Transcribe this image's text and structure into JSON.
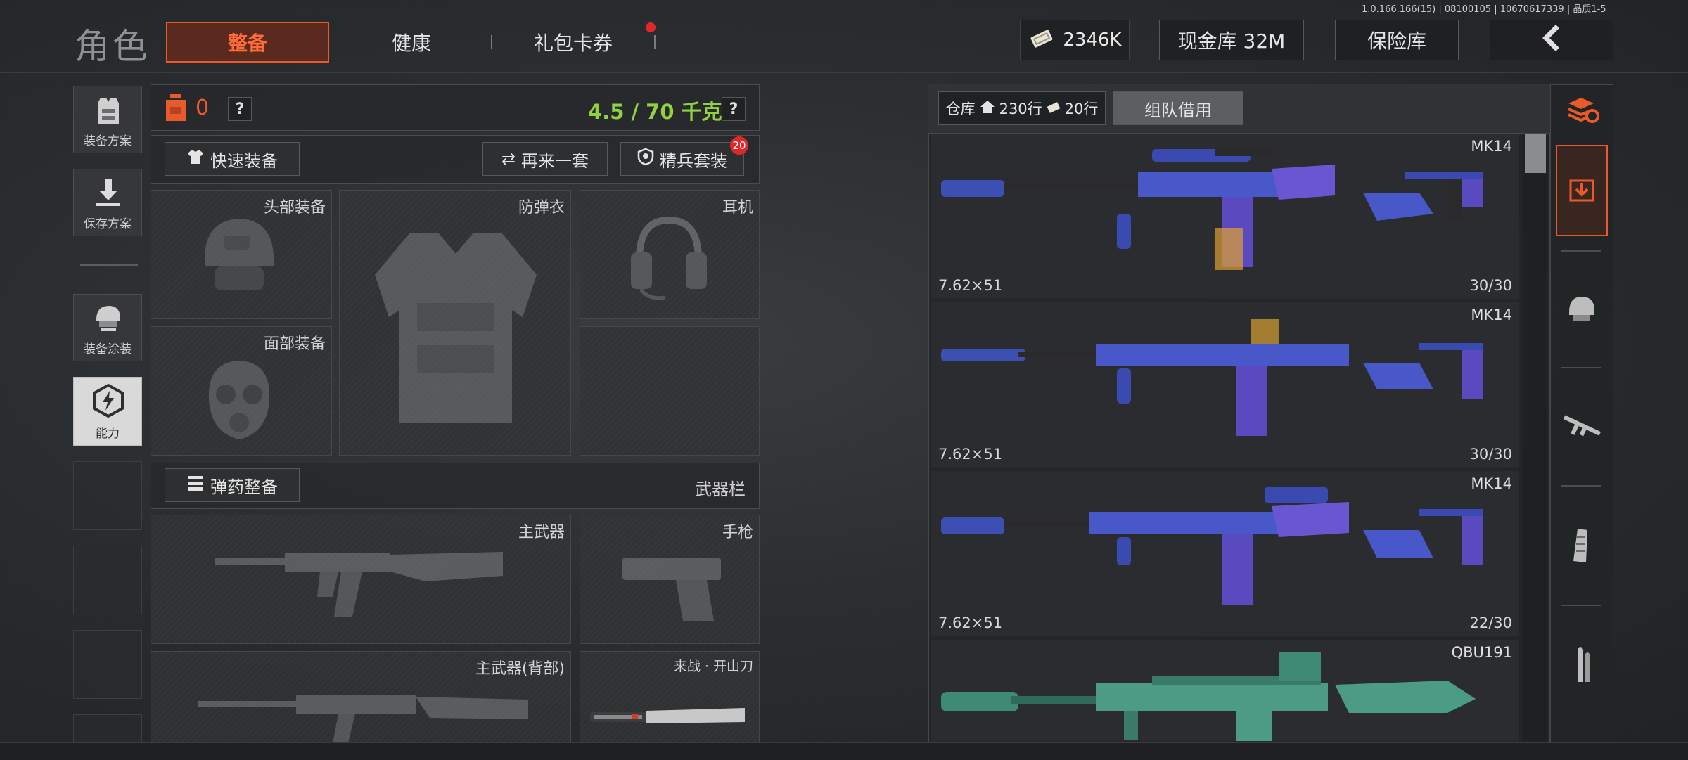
{
  "header": {
    "title": "角色",
    "tabs": [
      {
        "label": "整备",
        "active": true
      },
      {
        "label": "健康",
        "active": false
      },
      {
        "label": "礼包卡券",
        "active": false,
        "notification_dot": true
      }
    ],
    "currency": {
      "value": "2346K",
      "icon": "banknote-icon"
    },
    "cash_vault": "现金库 32M",
    "safe_vault": "保险库",
    "back_icon": "chevron-left-icon",
    "build_info": "1.0.166.166(15) | 08100105 | 10670617339 | 晶质1-5"
  },
  "left_tabs": [
    {
      "label": "装备方案",
      "icon": "vest-plan-icon"
    },
    {
      "label": "保存方案",
      "icon": "download-icon"
    },
    {
      "label": "装备涂装",
      "icon": "helmet-paint-icon"
    },
    {
      "label": "能力",
      "icon": "lightning-icon",
      "active": true
    }
  ],
  "loadout": {
    "backpack_count": "0",
    "weight": "4.5 / 70 千克",
    "help_label": "?",
    "quick_equip": "快速装备",
    "again_set": "再来一套",
    "elite_set": "精兵套装",
    "elite_badge": "20",
    "slots": {
      "head": "头部装备",
      "armor": "防弹衣",
      "headset": "耳机",
      "face": "面部装备"
    },
    "ammo_equip": "弹药整备",
    "weapon_bar": "武器栏",
    "weapon_slots": {
      "primary": "主武器",
      "pistol": "手枪",
      "primary_back": "主武器(背部)",
      "melee": "来战 · 开山刀"
    }
  },
  "storage": {
    "label": "仓库",
    "rows": "230行",
    "slots": "20行",
    "team_borrow": "组队借用",
    "weapons": [
      {
        "name": "MK14",
        "caliber": "7.62×51",
        "ammo": "30/30"
      },
      {
        "name": "MK14",
        "caliber": "7.62×51",
        "ammo": "30/30"
      },
      {
        "name": "MK14",
        "caliber": "7.62×51",
        "ammo": "22/30"
      },
      {
        "name": "QBU191",
        "caliber": "",
        "ammo": ""
      }
    ]
  },
  "filter_icons": [
    "stack-refresh-icon",
    "storage-download-icon",
    "helmet-icon",
    "rifle-icon",
    "magazine-icon",
    "bullet-icon"
  ],
  "colors": {
    "accent": "#e85a2c",
    "active_tab_bg": "#5a2a1e",
    "weight_green": "#8fd13f",
    "badge_red": "#e02828"
  }
}
